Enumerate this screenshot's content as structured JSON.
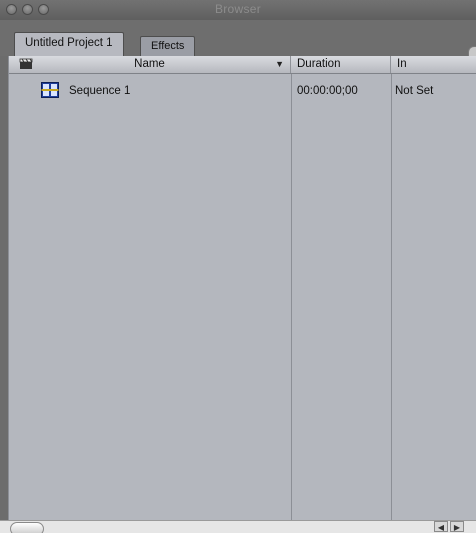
{
  "window": {
    "title": "Browser"
  },
  "tabs": [
    {
      "label": "Untitled Project 1",
      "active": true
    },
    {
      "label": "Effects",
      "active": false
    }
  ],
  "table": {
    "columns": [
      {
        "key": "name",
        "label": "Name",
        "sort": "descending"
      },
      {
        "key": "duration",
        "label": "Duration"
      },
      {
        "key": "in",
        "label": "In"
      }
    ],
    "rows": [
      {
        "icon": "sequence-icon",
        "name": "Sequence 1",
        "duration": "00:00:00;00",
        "in": "Not Set"
      }
    ]
  },
  "icons": {
    "header_icon": "clapperboard-icon",
    "sort_icon": "sort-down-triangle-icon",
    "scroll_left": "scroll-left-arrow-icon",
    "scroll_right": "scroll-right-arrow-icon"
  },
  "colors": {
    "window_chrome": "#6c6c6c",
    "table_background": "#b4b7be",
    "active_tab": "#b7b9c0",
    "inactive_tab": "#9a9da5"
  }
}
